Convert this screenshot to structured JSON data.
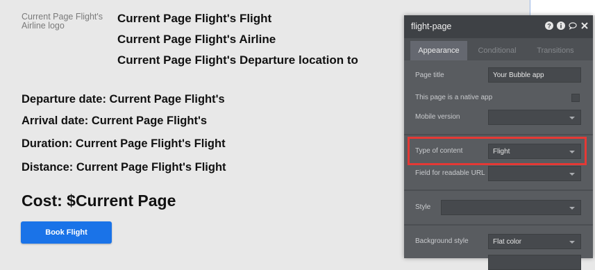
{
  "page": {
    "logo_alt": "Current Page Flight's Airline logo",
    "header_lines": [
      "Current Page Flight's Flight",
      "Current Page Flight's Airline",
      "Current Page Flight's Departure location to"
    ],
    "details": [
      "Departure date: Current Page Flight's",
      "Arrival date: Current Page Flight's",
      "Duration: Current Page Flight's Flight",
      "Distance: Current Page Flight's Flight"
    ],
    "cost": "Cost: $Current Page",
    "book_button": "Book Flight",
    "button_color": "#1a73e8"
  },
  "panel": {
    "title": "flight-page",
    "header_icons": [
      "help-icon",
      "info-icon",
      "comment-icon",
      "close-icon"
    ],
    "tabs": [
      {
        "label": "Appearance",
        "active": true
      },
      {
        "label": "Conditional",
        "active": false
      },
      {
        "label": "Transitions",
        "active": false
      }
    ],
    "properties": {
      "page_title_label": "Page title",
      "page_title_value": "Your Bubble app",
      "native_app_label": "This page is a native app",
      "mobile_version_label": "Mobile version",
      "mobile_version_value": "",
      "type_of_content_label": "Type of content",
      "type_of_content_value": "Flight",
      "readable_url_label": "Field for readable URL",
      "readable_url_value": "",
      "style_label": "Style",
      "style_value": "",
      "background_style_label": "Background style",
      "background_style_value": "Flat color"
    },
    "highlight_color": "#e53935"
  }
}
